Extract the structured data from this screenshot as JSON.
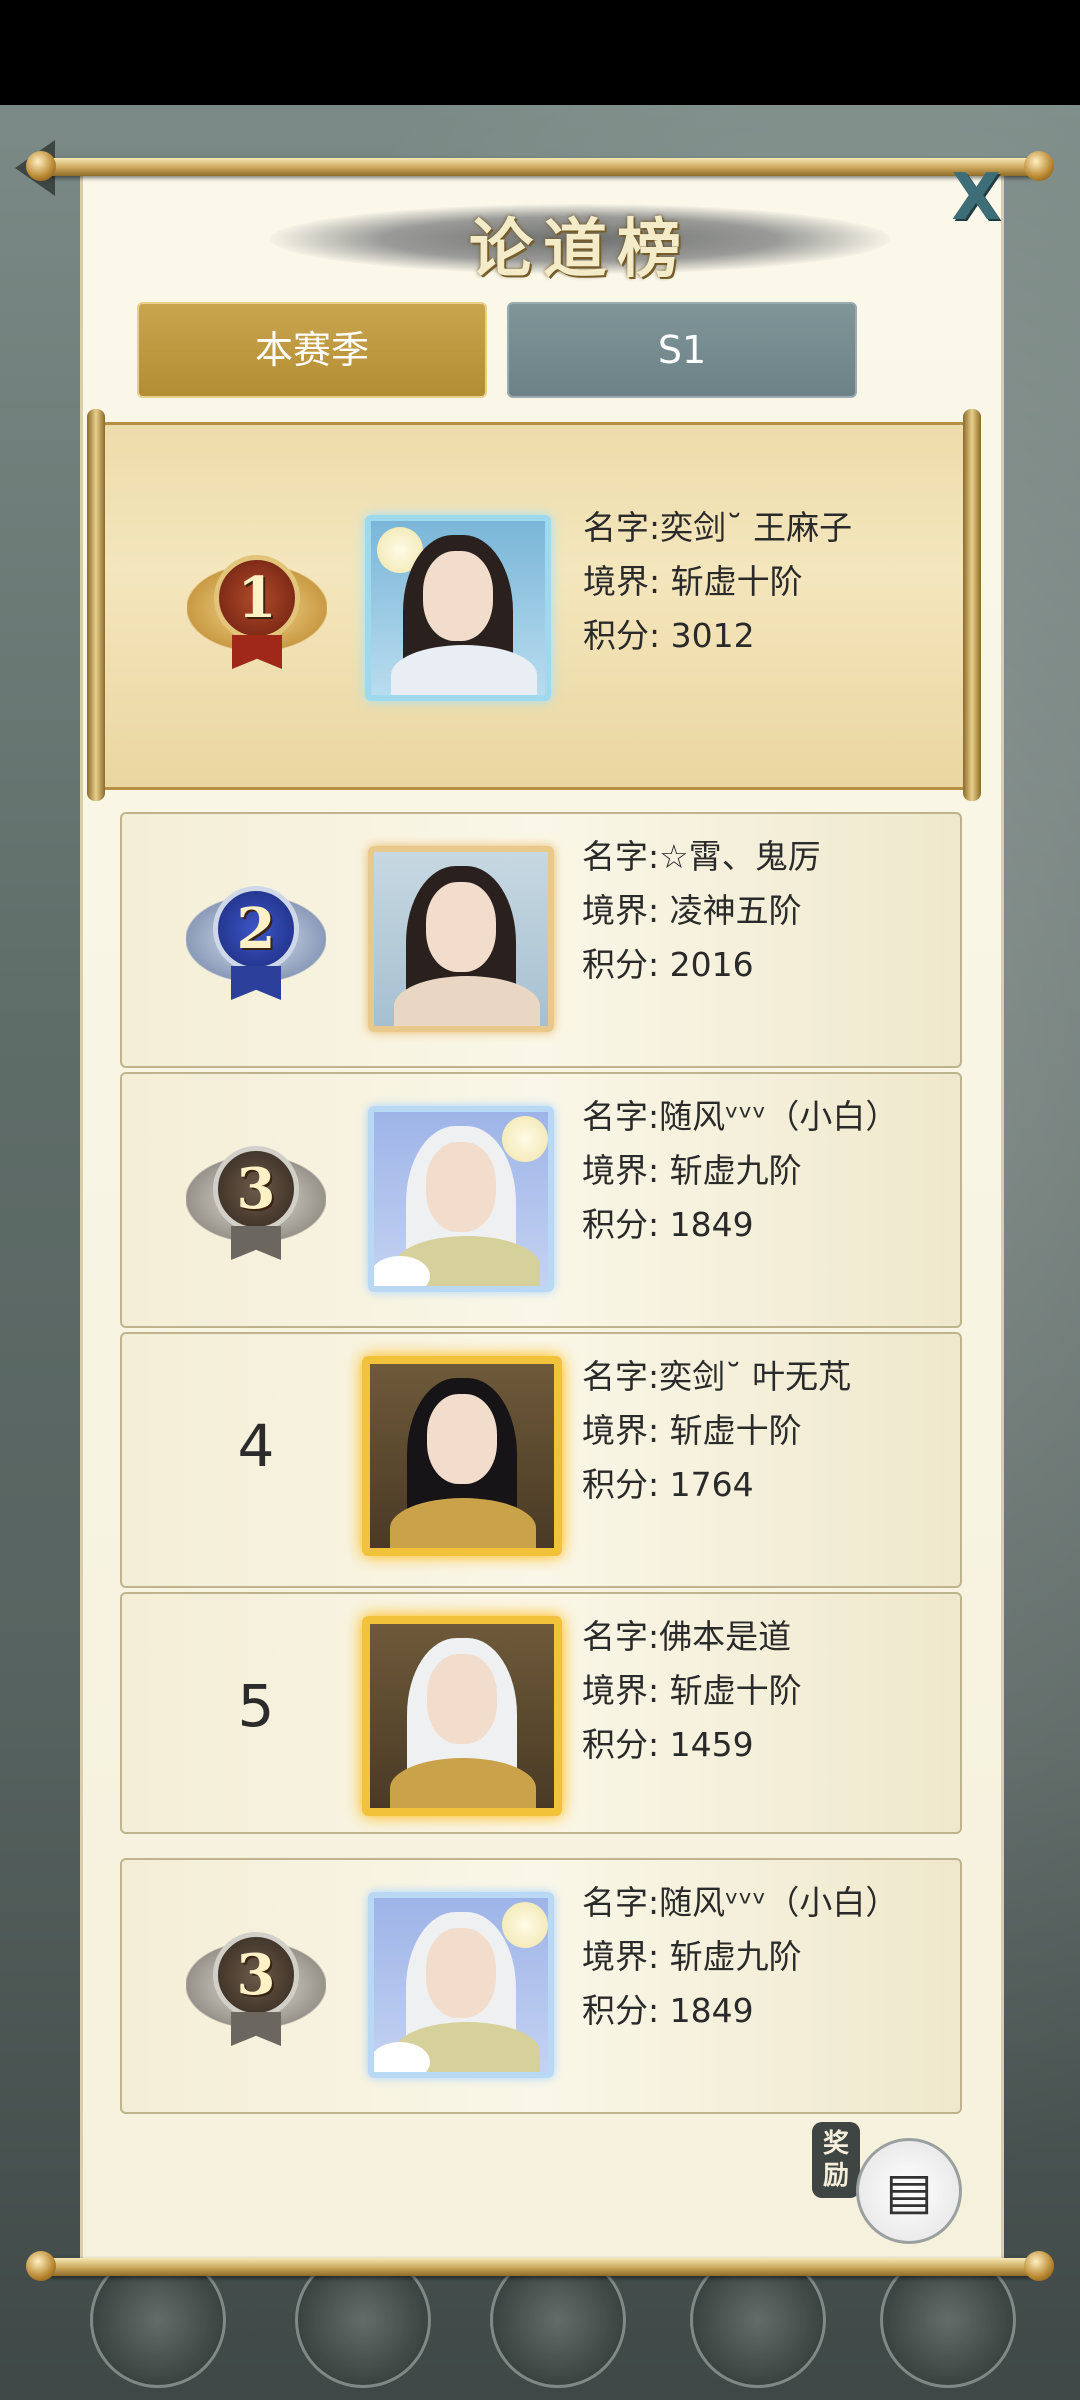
{
  "title": "论道榜",
  "close_label": "X",
  "tabs": [
    {
      "label": "本赛季"
    },
    {
      "label": "S1"
    }
  ],
  "info_labels": {
    "name": "名字:",
    "realm": "境界: ",
    "score": "积分: "
  },
  "rankings": [
    {
      "rank": "1",
      "name": "奕剑˘ 王麻子",
      "realm": "斩虚十阶",
      "score": "3012"
    },
    {
      "rank": "2",
      "name": "☆霄、鬼厉",
      "realm": "凌神五阶",
      "score": "2016"
    },
    {
      "rank": "3",
      "name": "随风ᵛᵛᵛ（小白）",
      "realm": "斩虚九阶",
      "score": "1849"
    },
    {
      "rank": "4",
      "name": "奕剑˘ 叶无芃",
      "realm": "斩虚十阶",
      "score": "1764"
    },
    {
      "rank": "5",
      "name": "佛本是道",
      "realm": "斩虚十阶",
      "score": "1459"
    }
  ],
  "my_rank": {
    "rank": "3",
    "name": "随风ᵛᵛᵛ（小白）",
    "realm": "斩虚九阶",
    "score": "1849"
  },
  "reward": {
    "label": "奖励",
    "icon": "treasure-chest-icon"
  },
  "colors": {
    "tab_active": "#c9a54e",
    "tab_inactive": "#7f9598",
    "panel": "#f8f4e2"
  }
}
